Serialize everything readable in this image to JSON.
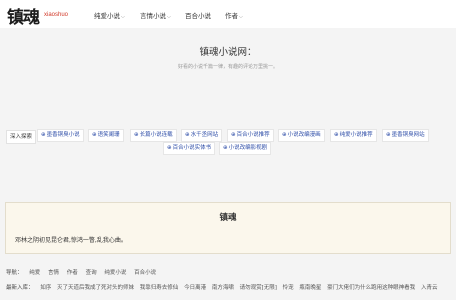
{
  "header": {
    "logo_text": "镇魂",
    "logo_sub": "xiaoshuo",
    "nav": [
      {
        "label": "纯爱小说",
        "has_dropdown": true
      },
      {
        "label": "言情小说",
        "has_dropdown": true
      },
      {
        "label": "百合小说",
        "has_dropdown": false
      },
      {
        "label": "作者",
        "has_dropdown": true
      }
    ]
  },
  "hero": {
    "title": "镇魂小说网：",
    "subtitle": "好看的小说千篇一律，有趣的评论万里挑一。"
  },
  "tags": {
    "label": "深入探索",
    "items": [
      "墨香铜臭小说",
      "语笑阑珊",
      "长篇小说连载",
      "水千丞网站",
      "百合小说推荐",
      "小说改编漫画",
      "纯爱小说推荐",
      "墨香铜臭网站",
      "百合小说实体书",
      "小说改编影视剧"
    ]
  },
  "card": {
    "title": "镇魂",
    "text": "邓林之阴初见昆仑君,惊鸿一瞥,乱我心曲。"
  },
  "footer": {
    "nav_label": "导航：",
    "nav_links": [
      "纯爱",
      "言情",
      "作者",
      "查询",
      "纯爱小说",
      "百合小说"
    ],
    "recent_label": "最新入库：",
    "recent_links": [
      "如序",
      "灭了天道后我成了死对头的师妹",
      "我靠归寿去修仙",
      "今日离港",
      "南方海啸",
      "请勿观赏[无限]",
      "怜宠",
      "瓶南晚星",
      "豪门大佬们为什么跑用这种眼神看我",
      "入青云"
    ]
  }
}
